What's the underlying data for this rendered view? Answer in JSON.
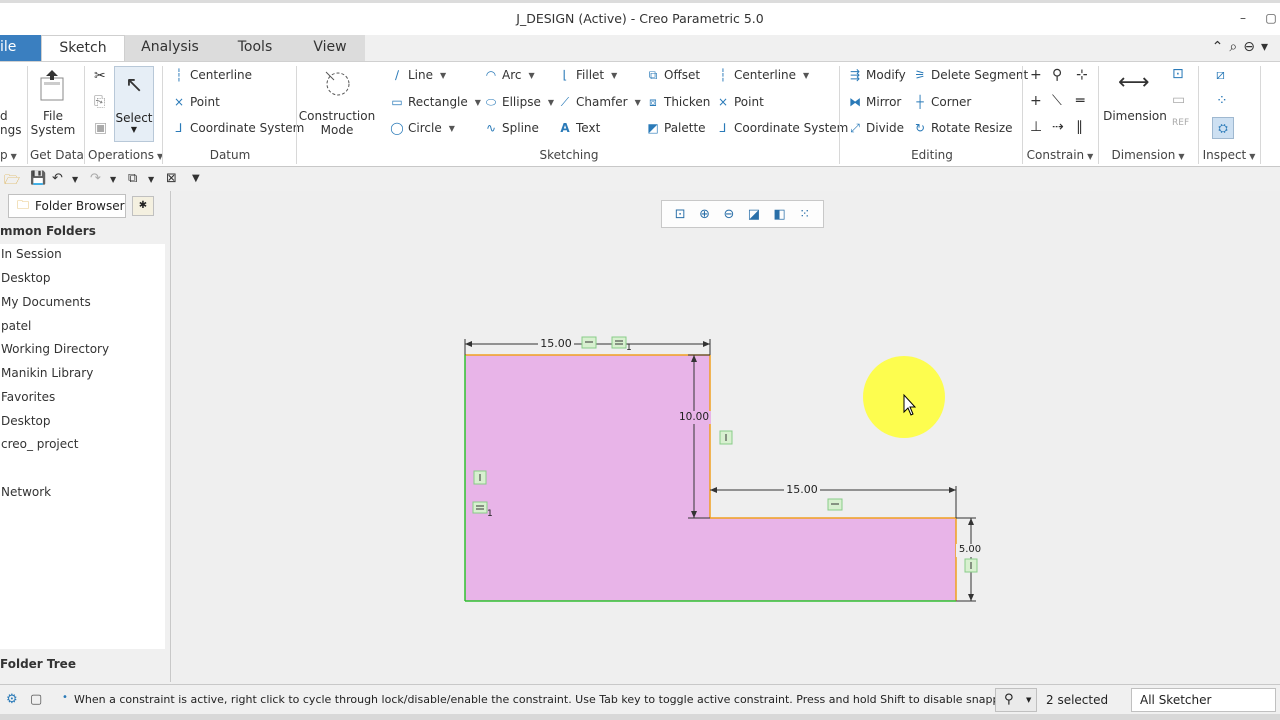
{
  "window": {
    "title": "J_DESIGN (Active) - Creo Parametric 5.0"
  },
  "tabs": [
    {
      "label": "ile"
    },
    {
      "label": "Sketch"
    },
    {
      "label": "Analysis"
    },
    {
      "label": "Tools"
    },
    {
      "label": "View"
    }
  ],
  "ribbon": {
    "left_cut": {
      "line1": "d",
      "line2": "ngs",
      "group": "p"
    },
    "get_data": {
      "label_line1": "File",
      "label_line2": "System",
      "group": "Get Data"
    },
    "operations": {
      "select": "Select",
      "group": "Operations"
    },
    "datum": {
      "items": [
        "Centerline",
        "Point",
        "Coordinate System"
      ],
      "group": "Datum"
    },
    "construction": {
      "line1": "Construction",
      "line2": "Mode"
    },
    "sketching": {
      "col1": [
        "Line",
        "Rectangle",
        "Circle"
      ],
      "col2": [
        "Arc",
        "Ellipse",
        "Spline"
      ],
      "col3": [
        "Fillet",
        "Chamfer",
        "Text"
      ],
      "col4": [
        "Offset",
        "Thicken",
        "Palette"
      ],
      "col5": [
        "Centerline",
        "Point",
        "Coordinate System"
      ],
      "group": "Sketching"
    },
    "editing": {
      "col1": [
        "Modify",
        "Mirror",
        "Divide"
      ],
      "col2": [
        "Delete Segment",
        "Corner",
        "Rotate Resize"
      ],
      "group": "Editing"
    },
    "constrain": {
      "group": "Constrain"
    },
    "dimension": {
      "label": "Dimension",
      "group": "Dimension"
    },
    "inspect": {
      "group": "Inspect"
    }
  },
  "left_panel": {
    "tab_label": "Folder Browser",
    "header": "mmon Folders",
    "folders": [
      "In Session",
      "Desktop",
      "My Documents",
      "patel",
      "Working Directory",
      "Manikin Library",
      "Favorites",
      "Desktop",
      "creo_ project",
      "Network"
    ],
    "footer": "Folder Tree"
  },
  "sketch": {
    "dims": {
      "top_width": "15.00",
      "height": "10.00",
      "step_width": "15.00",
      "step_height": "5.00"
    },
    "constraint_sub": "1",
    "fill_color": "#e8b4e8"
  },
  "status": {
    "message": "When a constraint is active, right click to cycle through lock/disable/enable the constraint. Use Tab key to toggle active constraint. Press and hold Shift to disable snappi",
    "selected": "2 selected",
    "filter": "All Sketcher"
  }
}
